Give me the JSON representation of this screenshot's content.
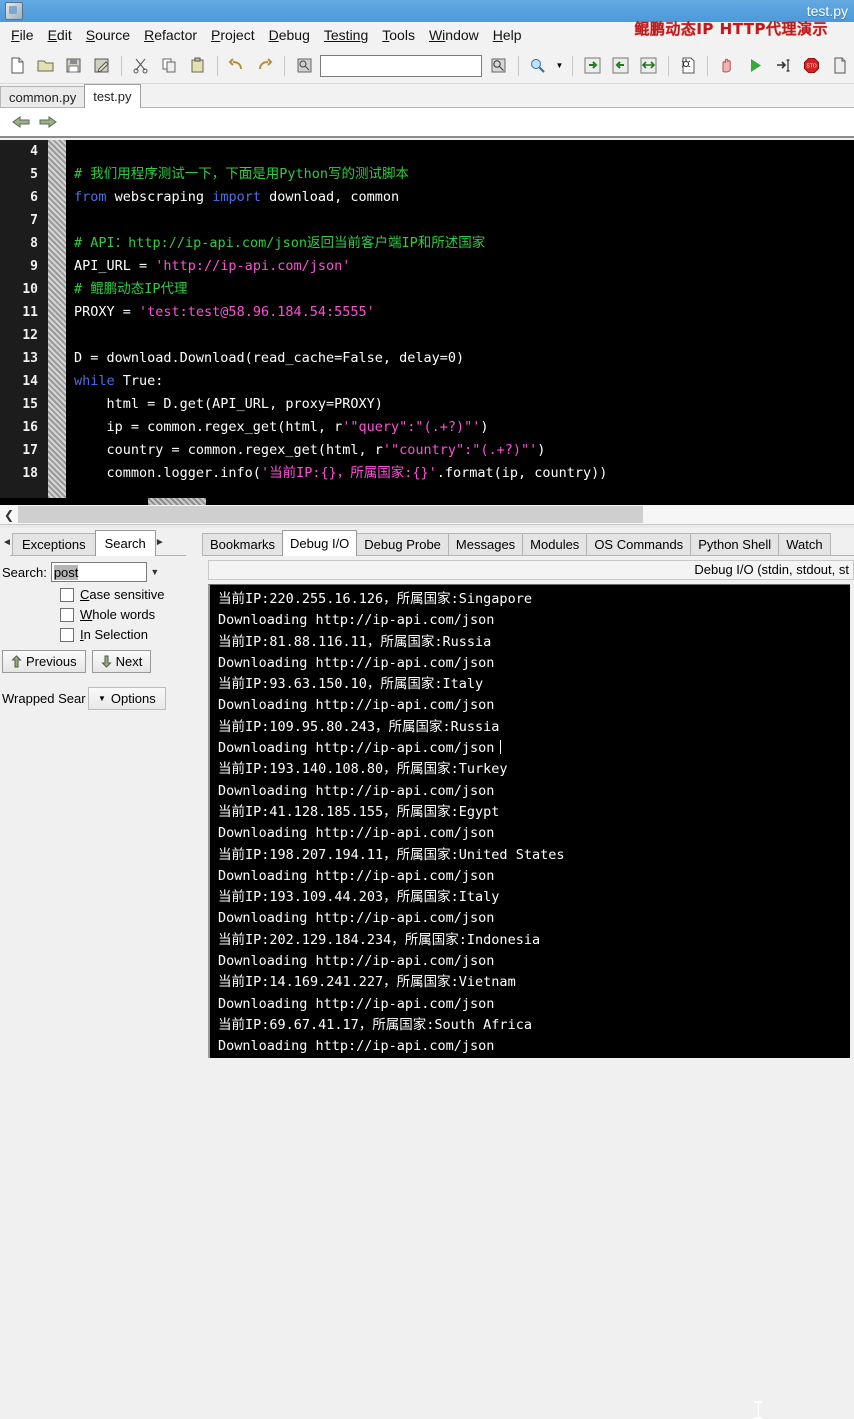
{
  "window": {
    "title": "test.py",
    "app_icon": "app-icon",
    "watermark": "鲲鹏动态IP HTTP代理演示"
  },
  "menubar": {
    "items": [
      {
        "label": "File",
        "pre": "F",
        "rest": "ile"
      },
      {
        "label": "Edit",
        "pre": "E",
        "rest": "dit"
      },
      {
        "label": "Source",
        "pre": "S",
        "rest": "ource"
      },
      {
        "label": "Refactor",
        "pre": "R",
        "rest": "efactor"
      },
      {
        "label": "Project",
        "pre": "P",
        "rest": "roject"
      },
      {
        "label": "Debug",
        "pre": "D",
        "rest": "ebug"
      },
      {
        "label": "Testing",
        "pre": "Testin",
        "rest": "g"
      },
      {
        "label": "Tools",
        "pre": "T",
        "rest": "ools"
      },
      {
        "label": "Window",
        "pre": "Wi",
        "rest": "ndow"
      },
      {
        "label": "Help",
        "pre": "H",
        "rest": "elp"
      }
    ]
  },
  "toolbar": {
    "search_value": "",
    "search_placeholder": "",
    "buttons": [
      {
        "name": "new-file-icon",
        "tooltip": "New"
      },
      {
        "name": "open-folder-icon",
        "tooltip": "Open"
      },
      {
        "name": "save-icon",
        "tooltip": "Save"
      },
      {
        "name": "save-as-icon",
        "tooltip": "Save As"
      },
      {
        "name": "cut-icon",
        "tooltip": "Cut"
      },
      {
        "name": "copy-icon",
        "tooltip": "Copy"
      },
      {
        "name": "paste-icon",
        "tooltip": "Paste"
      },
      {
        "name": "undo-icon",
        "tooltip": "Undo"
      },
      {
        "name": "redo-icon",
        "tooltip": "Redo"
      },
      {
        "name": "find-icon",
        "tooltip": "Find"
      },
      {
        "name": "find-go-icon",
        "tooltip": "Find Next"
      },
      {
        "name": "zoom-search-icon",
        "tooltip": "Search"
      },
      {
        "name": "step-forward-icon",
        "tooltip": "Forward"
      },
      {
        "name": "step-back-icon",
        "tooltip": "Back"
      },
      {
        "name": "step-both-icon",
        "tooltip": "Both"
      },
      {
        "name": "debug-script-icon",
        "tooltip": "Debug File"
      },
      {
        "name": "pause-hand-icon",
        "tooltip": "Pause"
      },
      {
        "name": "run-icon",
        "tooltip": "Run"
      },
      {
        "name": "step-into-icon",
        "tooltip": "Step Into"
      },
      {
        "name": "stop-icon",
        "tooltip": "Stop"
      },
      {
        "name": "restart-icon",
        "tooltip": "Restart"
      }
    ]
  },
  "file_tabs": {
    "tabs": [
      {
        "label": "common.py",
        "active": false
      },
      {
        "label": "test.py",
        "active": true
      }
    ]
  },
  "nav": {
    "back_icon": "back-arrow-icon",
    "forward_icon": "forward-arrow-icon"
  },
  "editor": {
    "first_line": 4,
    "lines": [
      {
        "num": 4,
        "fold": false,
        "tokens": []
      },
      {
        "num": 5,
        "fold": false,
        "tokens": [
          {
            "t": "# 我们用程序测试一下，下面是用Python写的测试脚本",
            "c": "c-com"
          }
        ]
      },
      {
        "num": 6,
        "fold": false,
        "tokens": [
          {
            "t": "from",
            "c": "c-kw"
          },
          {
            "t": " webscraping ",
            "c": ""
          },
          {
            "t": "import",
            "c": "c-kw"
          },
          {
            "t": " download, common",
            "c": ""
          }
        ]
      },
      {
        "num": 7,
        "fold": false,
        "tokens": []
      },
      {
        "num": 8,
        "fold": false,
        "tokens": [
          {
            "t": "# API：http://ip-api.com/json返回当前客户端IP和所述国家",
            "c": "c-com"
          }
        ]
      },
      {
        "num": 9,
        "fold": false,
        "tokens": [
          {
            "t": "API_URL = ",
            "c": ""
          },
          {
            "t": "'http://ip-api.com/json'",
            "c": "c-str"
          }
        ]
      },
      {
        "num": 10,
        "fold": false,
        "tokens": [
          {
            "t": "# 鲲鹏动态IP代理",
            "c": "c-com"
          }
        ]
      },
      {
        "num": 11,
        "fold": false,
        "tokens": [
          {
            "t": "PROXY = ",
            "c": ""
          },
          {
            "t": "'test:test@58.96.184.54:5555'",
            "c": "c-str"
          }
        ]
      },
      {
        "num": 12,
        "fold": false,
        "tokens": []
      },
      {
        "num": 13,
        "fold": false,
        "tokens": [
          {
            "t": "D = download.Download(read_cache=False, delay=0)",
            "c": ""
          }
        ]
      },
      {
        "num": 14,
        "fold": true,
        "tokens": [
          {
            "t": "while",
            "c": "c-kw"
          },
          {
            "t": " True:",
            "c": ""
          }
        ]
      },
      {
        "num": 15,
        "fold": false,
        "tokens": [
          {
            "t": "    html = D.get(API_URL, proxy=PROXY)",
            "c": ""
          }
        ]
      },
      {
        "num": 16,
        "fold": false,
        "tokens": [
          {
            "t": "    ip = common.regex_get(html, r",
            "c": ""
          },
          {
            "t": "'\"query\":\"(.+?)\"'",
            "c": "c-str"
          },
          {
            "t": ")",
            "c": ""
          }
        ]
      },
      {
        "num": 17,
        "fold": false,
        "tokens": [
          {
            "t": "    country = common.regex_get(html, r",
            "c": ""
          },
          {
            "t": "'\"country\":\"(.+?)\"'",
            "c": "c-str"
          },
          {
            "t": ")",
            "c": ""
          }
        ]
      },
      {
        "num": 18,
        "fold": false,
        "tokens": [
          {
            "t": "    common.logger.info(",
            "c": ""
          },
          {
            "t": "'当前IP:{}，所属国家:{}'",
            "c": "c-str"
          },
          {
            "t": ".format(ip, country))",
            "c": ""
          }
        ]
      }
    ]
  },
  "search_panel": {
    "tabs": [
      {
        "label": "Exceptions",
        "active": false
      },
      {
        "label": "Search",
        "active": true
      }
    ],
    "scroll_left_icon": "scroll-left-icon",
    "scroll_right_icon": "scroll-right-icon",
    "search_label": "Search:",
    "search_value": "post",
    "dropdown_icon": "chevron-down-icon",
    "checkboxes": [
      {
        "label": "Case sensitive",
        "checked": false
      },
      {
        "label": "Whole words",
        "checked": false
      },
      {
        "label": "In Selection",
        "checked": false
      }
    ],
    "previous_label": "Previous",
    "previous_icon": "arrow-up-icon",
    "next_label": "Next",
    "next_icon": "arrow-down-icon",
    "wrapped_label": "Wrapped Sear",
    "options_label": "Options",
    "options_icon": "chevron-down-icon"
  },
  "debug_panel": {
    "tabs": [
      {
        "label": "Bookmarks",
        "active": false
      },
      {
        "label": "Debug I/O",
        "active": true
      },
      {
        "label": "Debug Probe",
        "active": false
      },
      {
        "label": "Messages",
        "active": false
      },
      {
        "label": "Modules",
        "active": false
      },
      {
        "label": "OS Commands",
        "active": false
      },
      {
        "label": "Python Shell",
        "active": false
      },
      {
        "label": "Watch",
        "active": false
      }
    ],
    "caption": "Debug I/O (stdin, stdout, st",
    "console_lines": [
      "当前IP:220.255.16.126，所属国家:Singapore",
      "Downloading http://ip-api.com/json",
      "当前IP:81.88.116.11，所属国家:Russia",
      "Downloading http://ip-api.com/json",
      "当前IP:93.63.150.10，所属国家:Italy",
      "Downloading http://ip-api.com/json",
      "当前IP:109.95.80.243，所属国家:Russia",
      "Downloading http://ip-api.com/json",
      "当前IP:193.140.108.80，所属国家:Turkey",
      "Downloading http://ip-api.com/json",
      "当前IP:41.128.185.155，所属国家:Egypt",
      "Downloading http://ip-api.com/json",
      "当前IP:198.207.194.11，所属国家:United States",
      "Downloading http://ip-api.com/json",
      "当前IP:193.109.44.203，所属国家:Italy",
      "Downloading http://ip-api.com/json",
      "当前IP:202.129.184.234，所属国家:Indonesia",
      "Downloading http://ip-api.com/json",
      "当前IP:14.169.241.227，所属国家:Vietnam",
      "Downloading http://ip-api.com/json",
      "当前IP:69.67.41.17，所属国家:South Africa",
      "Downloading http://ip-api.com/json"
    ],
    "caret_after_line_index": 7
  },
  "colors": {
    "titlebar": "#56a0dd",
    "watermark": "#c11a1a",
    "comment": "#2ecc40",
    "keyword": "#4a6fe8",
    "string": "#ff4fd8",
    "editor_bg": "#000000",
    "console_bg": "#000000",
    "console_fg": "#ffffff",
    "chrome_bg": "#f0f0f0"
  }
}
